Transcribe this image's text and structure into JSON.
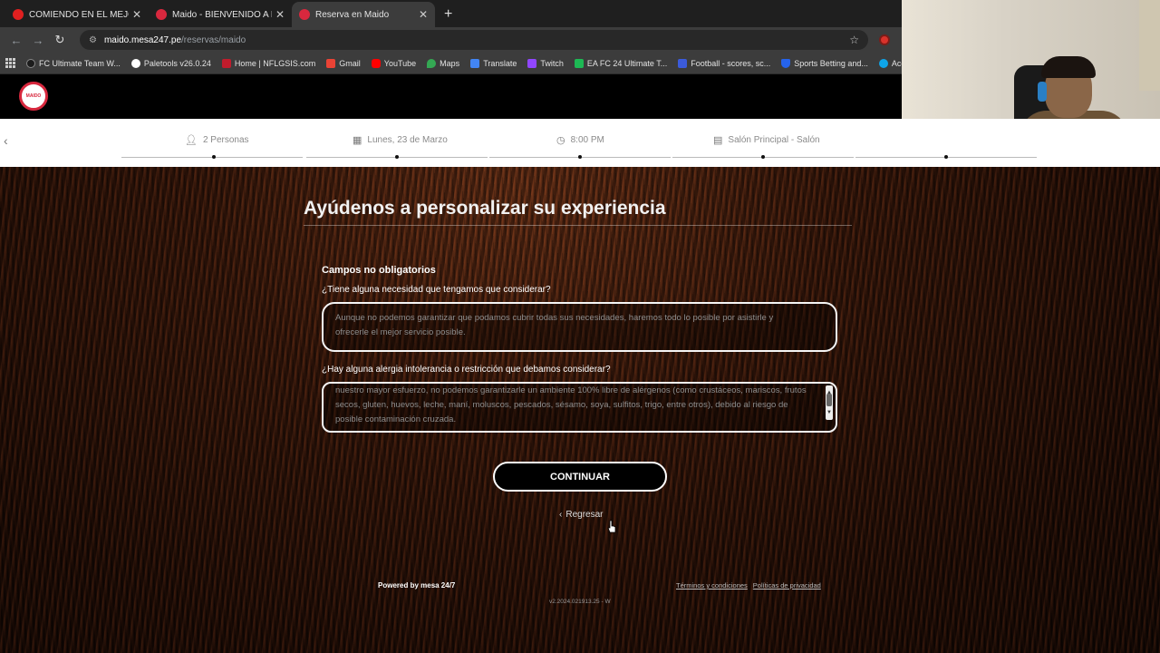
{
  "browser": {
    "tabs": [
      {
        "title": "COMIENDO EN EL MEJOR REST",
        "favicon_color": "#e02020",
        "active": false
      },
      {
        "title": "Maido - BIENVENIDO A NUEST",
        "favicon_color": "#d8283e",
        "active": false
      },
      {
        "title": "Reserva en Maido",
        "favicon_color": "#d8283e",
        "active": true
      }
    ],
    "new_tab": "+",
    "url_host": "maido.mesa247.pe",
    "url_path": "/reservas/maido",
    "bookmarks": [
      {
        "label": "FC Ultimate Team W...",
        "color": "#1c1c1c"
      },
      {
        "label": "Paletools v26.0.24",
        "color": "#ffffff"
      },
      {
        "label": "Home | NFLGSIS.com",
        "color": "#c01c2c"
      },
      {
        "label": "Gmail",
        "color": "#ea4335"
      },
      {
        "label": "YouTube",
        "color": "#ff0000"
      },
      {
        "label": "Maps",
        "color": "#34a853"
      },
      {
        "label": "Translate",
        "color": "#4285f4"
      },
      {
        "label": "Twitch",
        "color": "#9146ff"
      },
      {
        "label": "EA FC 24 Ultimate T...",
        "color": "#1db954"
      },
      {
        "label": "Football - scores, sc...",
        "color": "#3b5bdb"
      },
      {
        "label": "Sports Betting and...",
        "color": "#2563eb"
      },
      {
        "label": "Acceder con Ellucia...",
        "color": "#0ea5e9"
      }
    ]
  },
  "site": {
    "logo_text": "MAIDO",
    "brand_color": "#d8283e"
  },
  "steps": [
    {
      "label": "2 Personas",
      "icon": "person-icon"
    },
    {
      "label": "Lunes, 23 de Marzo",
      "icon": "calendar-icon"
    },
    {
      "label": "8:00 PM",
      "icon": "clock-icon"
    },
    {
      "label": "Salón Principal - Salón",
      "icon": "clipboard-icon"
    }
  ],
  "form": {
    "title": "Ayúdenos a personalizar su experiencia",
    "section_heading": "Campos no obligatorios",
    "q1_label": "¿Tiene alguna necesidad que tengamos que considerar?",
    "q1_placeholder": "Aunque no podemos garantizar que podamos cubrir todas sus necesidades, haremos todo lo posible por asistirle y ofrecerle el mejor servicio posible.",
    "q2_label": "¿Hay alguna alergia intolerancia o restricción que debamos considerar?",
    "q2_placeholder": "nuestro mayor esfuerzo, no podemos garantizarle un ambiente 100% libre de alérgenos (como crustáceos, mariscos, frutos secos, gluten, huevos, leche, maní, moluscos, pescados, sésamo, soya, sulfitos, trigo, entre otros), debido al riesgo de posible contaminación cruzada.",
    "continue_label": "CONTINUAR",
    "back_label": "Regresar"
  },
  "footer": {
    "powered": "Powered by mesa 24/7",
    "terms": "Términos y condiciones",
    "privacy": "Políticas de privacidad",
    "version": "v2.2024.021913.25 - W"
  }
}
